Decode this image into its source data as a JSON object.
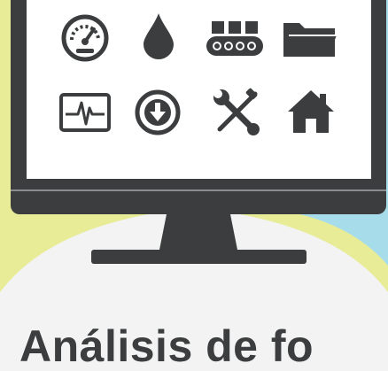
{
  "colors": {
    "monitor": "#3b3d3e",
    "screen": "#ffffff",
    "accent_yellow": "#e8ec97",
    "accent_blue": "#a7dcea",
    "page_bg": "#f2f3f2",
    "text": "#3b3d3e"
  },
  "icons": [
    "gauge-icon",
    "water-drop-icon",
    "conveyor-icon",
    "folder-icon",
    "heartbeat-monitor-icon",
    "download-circle-icon",
    "tools-icon",
    "home-icon"
  ],
  "caption": {
    "text": "Análisis de fo"
  }
}
